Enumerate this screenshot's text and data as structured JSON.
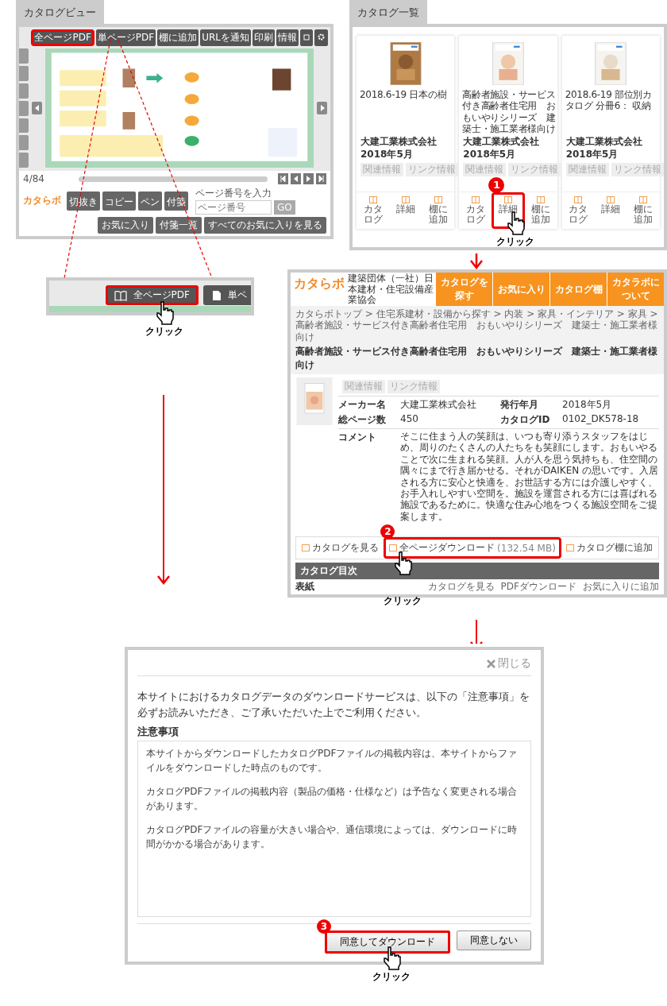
{
  "viewer": {
    "tab_label": "カタログビュー",
    "toolbar": [
      {
        "label": "全ページPDF",
        "highlighted": true
      },
      {
        "label": "単ページPDF",
        "highlighted": false
      },
      {
        "label": "棚に追加",
        "highlighted": false
      },
      {
        "label": "URLを通知",
        "highlighted": false
      },
      {
        "label": "印刷",
        "highlighted": false
      },
      {
        "label": "情報",
        "highlighted": false
      }
    ],
    "page_indicator": "4/84",
    "page_input_label": "ページ番号を入力",
    "page_input_placeholder": "ページ番号",
    "go": "GO",
    "logo": "カタらボ",
    "tools": [
      "切抜き",
      "コピー",
      "ペン",
      "付箋"
    ],
    "favorite_buttons": [
      "お気に入り",
      "付箋一覧",
      "すべてのお気に入りを見る"
    ]
  },
  "callout": {
    "button": {
      "label": "全ページPDF",
      "highlighted": true,
      "click": "クリック"
    },
    "next_button": "単ペ"
  },
  "catalog_list": {
    "tab_label": "カタログ一覧",
    "cards": [
      {
        "title": "2018.6-19 日本の樹",
        "maker": "大建工業株式会社",
        "date": "2018年5月",
        "tags": [
          "関連情報",
          "リンク情報"
        ],
        "actions": [
          {
            "label": "カタログ",
            "highlighted": false
          },
          {
            "label": "詳細",
            "highlighted": false
          },
          {
            "label": "棚に追加",
            "highlighted": false
          }
        ]
      },
      {
        "title": "高齢者施設・サービス付き高齢者住宅用　おもいやりシリーズ　建築士・施工業者様向け",
        "maker": "大建工業株式会社",
        "date": "2018年5月",
        "tags": [
          "関連情報",
          "リンク情報"
        ],
        "actions": [
          {
            "label": "カタログ",
            "highlighted": false
          },
          {
            "label": "詳細",
            "highlighted": true,
            "step": "1",
            "click": "クリック"
          },
          {
            "label": "棚に追加",
            "highlighted": false
          }
        ]
      },
      {
        "title": "2018.6-19 部位別カタログ 分冊6： 収納",
        "maker": "大建工業株式会社",
        "date": "2018年5月",
        "tags": [
          "関連情報",
          "リンク情報"
        ],
        "actions": [
          {
            "label": "カタログ",
            "highlighted": false
          },
          {
            "label": "詳細",
            "highlighted": false
          },
          {
            "label": "棚に追加",
            "highlighted": false
          }
        ]
      }
    ]
  },
  "detail": {
    "logo": "カタらボ",
    "org": "建築団体（一社）日本建材・住宅設備産業協会",
    "nav": [
      "カタログを探す",
      "お気に入り",
      "カタログ棚",
      "カタラボについて"
    ],
    "breadcrumb": "カタらボトップ > 住宅系建材・設備から探す > 内装 > 家具・インテリア > 家具 > 高齢者施設・サービス付き高齢者住宅用　おもいやりシリーズ　建築士・施工業者様向け",
    "title": "高齢者施設・サービス付き高齢者住宅用　おもいやりシリーズ　建築士・施工業者様向け",
    "tags": [
      "関連情報",
      "リンク情報"
    ],
    "fields": [
      {
        "label": "メーカー名",
        "value": "大建工業株式会社"
      },
      {
        "label": "発行年月",
        "value": "2018年5月"
      },
      {
        "label": "総ページ数",
        "value": "450"
      },
      {
        "label": "カタログID",
        "value": "0102_DK578-18"
      }
    ],
    "comment_label": "コメント",
    "comment": "そこに住まう人の笑顔は、いつも寄り添うスタッフをはじめ、周りのたくさんの人たちをも笑顔にします。おもいやることで次に生まれる笑顔。人が人を思う気持ちも、住空間の隅々にまで行き届かせる。それがDAIKEN の思いです。入居される方に安心と快適を、お世話する方には介護しやすく、お手入れしやすい空間を。施設を運営される方には喜ばれる施設であるために。快適な住み心地をつくる施設空間をご提案します。",
    "actions": [
      {
        "label": "カタログを見る",
        "highlighted": false
      },
      {
        "label": "全ページダウンロード",
        "size": "(132.54 MB)",
        "highlighted": true,
        "step": "2",
        "click": "クリック"
      },
      {
        "label": "カタログ棚に追加",
        "highlighted": false
      }
    ],
    "toc_title": "カタログ目次",
    "toc_row": {
      "name": "表紙",
      "links": [
        "カタログを見る",
        "PDFダウンロード",
        "お気に入りに追加"
      ]
    }
  },
  "dialog": {
    "close": "閉じる",
    "intro": "本サイトにおけるカタログデータのダウンロードサービスは、以下の「注意事項」を必ずお読みいただき、ご了承いただいた上でご利用ください。",
    "notes_title": "注意事項",
    "notes": [
      "本サイトからダウンロードしたカタログPDFファイルの掲載内容は、本サイトからファイルをダウンロードした時点のものです。",
      "カタログPDFファイルの掲載内容（製品の価格・仕様など）は予告なく変更される場合があります。",
      "カタログPDFファイルの容量が大きい場合や、通信環境によっては、ダウンロードに時間がかかる場合があります。"
    ],
    "buttons": [
      {
        "label": "同意してダウンロード",
        "highlighted": true,
        "step": "3",
        "click": "クリック"
      },
      {
        "label": "同意しない",
        "highlighted": false
      }
    ]
  }
}
